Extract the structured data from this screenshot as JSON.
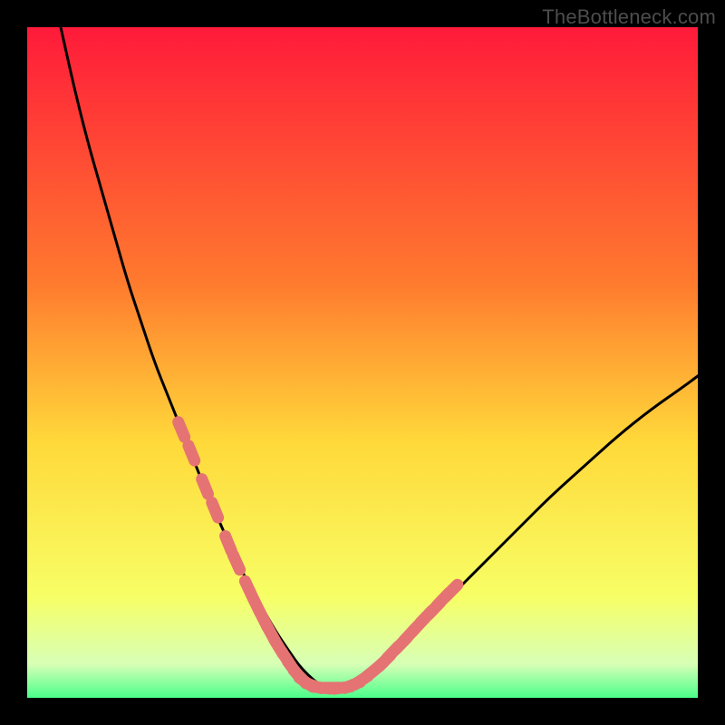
{
  "watermark": "TheBottleneck.com",
  "colors": {
    "frame": "#000000",
    "grad_top": "#ff1a3a",
    "grad_mid1": "#ff7a2e",
    "grad_mid2": "#ffd93a",
    "grad_low": "#f7ff66",
    "grad_base1": "#d7ffb6",
    "grad_base2": "#4aff8a",
    "curve": "#000000",
    "salmon": "#e57373"
  },
  "chart_data": {
    "type": "line",
    "title": "",
    "xlabel": "",
    "ylabel": "",
    "xlim": [
      0,
      100
    ],
    "ylim": [
      0,
      100
    ],
    "series": [
      {
        "name": "bottleneck-curve",
        "x": [
          5,
          7,
          9,
          11,
          13,
          15,
          17,
          19,
          21,
          23,
          25,
          27,
          29,
          31,
          33,
          35,
          37,
          39,
          41,
          44,
          48,
          53,
          58,
          63,
          68,
          73,
          78,
          83,
          88,
          93,
          98,
          100
        ],
        "y": [
          100,
          91,
          83,
          76,
          69,
          62,
          56,
          50,
          45,
          40,
          35,
          30,
          25.5,
          21,
          17,
          13.5,
          10,
          7,
          4.2,
          1.5,
          1.5,
          5,
          10,
          15,
          20,
          25,
          30,
          34.5,
          39,
          43,
          46.5,
          48
        ]
      }
    ],
    "markers": {
      "name": "salmon-dashes",
      "points": [
        {
          "x": 23.0,
          "y": 40.0
        },
        {
          "x": 24.5,
          "y": 36.5
        },
        {
          "x": 26.5,
          "y": 31.5
        },
        {
          "x": 28.0,
          "y": 28.0
        },
        {
          "x": 30.0,
          "y": 23.0
        },
        {
          "x": 31.2,
          "y": 20.2
        },
        {
          "x": 33.0,
          "y": 16.3
        },
        {
          "x": 34.2,
          "y": 13.8
        },
        {
          "x": 35.3,
          "y": 11.6
        },
        {
          "x": 36.3,
          "y": 9.7
        },
        {
          "x": 37.5,
          "y": 7.6
        },
        {
          "x": 38.6,
          "y": 5.9
        },
        {
          "x": 39.6,
          "y": 4.4
        },
        {
          "x": 40.6,
          "y": 3.2
        },
        {
          "x": 41.6,
          "y": 2.3
        },
        {
          "x": 42.7,
          "y": 1.8
        },
        {
          "x": 44.0,
          "y": 1.5
        },
        {
          "x": 45.5,
          "y": 1.5
        },
        {
          "x": 47.0,
          "y": 1.5
        },
        {
          "x": 48.5,
          "y": 1.9
        },
        {
          "x": 49.8,
          "y": 2.6
        },
        {
          "x": 51.0,
          "y": 3.5
        },
        {
          "x": 52.2,
          "y": 4.5
        },
        {
          "x": 53.3,
          "y": 5.5
        },
        {
          "x": 54.5,
          "y": 6.8
        },
        {
          "x": 55.8,
          "y": 8.1
        },
        {
          "x": 57.0,
          "y": 9.4
        },
        {
          "x": 58.3,
          "y": 10.8
        },
        {
          "x": 59.5,
          "y": 12.1
        },
        {
          "x": 60.7,
          "y": 13.3
        },
        {
          "x": 62.0,
          "y": 14.7
        },
        {
          "x": 63.3,
          "y": 16.0
        }
      ]
    }
  }
}
